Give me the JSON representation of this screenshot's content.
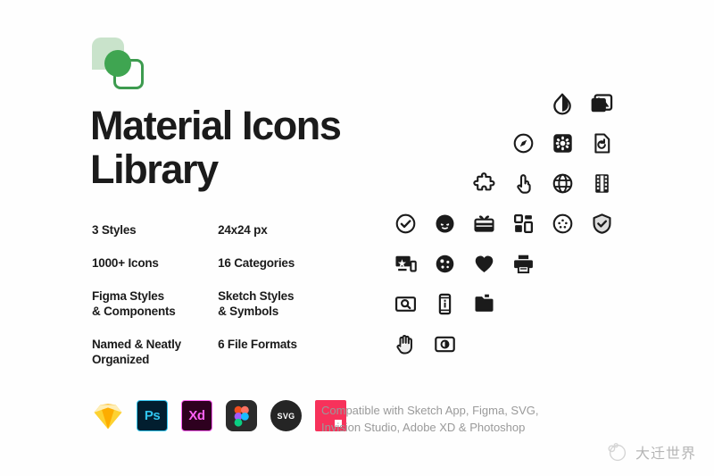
{
  "brand": {
    "logo_name": "material-icons-logo",
    "colors": {
      "leaf": "#c9e3cb",
      "circle": "#3fa551",
      "square_outline": "#3d9b4f",
      "title": "#1b1b1b",
      "muted_text": "#9a9a9a",
      "background": "#fefefe"
    }
  },
  "header": {
    "title_line1": "Material Icons",
    "title_line2": "Library"
  },
  "stats": [
    {
      "left": [
        "3 Styles"
      ],
      "right": [
        "24x24 px"
      ]
    },
    {
      "left": [
        "1000+ Icons"
      ],
      "right": [
        "16 Categories"
      ]
    },
    {
      "left": [
        "Figma Styles",
        "& Components"
      ],
      "right": [
        "Sketch Styles",
        "& Symbols"
      ]
    },
    {
      "left": [
        "Named & Neatly",
        "Organized"
      ],
      "right": [
        "6 File Formats"
      ]
    }
  ],
  "icon_grid": {
    "columns": 6,
    "rows": [
      {
        "offset": 4,
        "icons": [
          "opacity-icon",
          "photo-library-icon"
        ]
      },
      {
        "offset": 3,
        "icons": [
          "explore-icon",
          "settings-applications-icon",
          "restore-page-icon"
        ]
      },
      {
        "offset": 2,
        "icons": [
          "extension-icon",
          "touch-app-icon",
          "language-icon",
          "theaters-icon"
        ]
      },
      {
        "offset": 0,
        "icons": [
          "check-circle-icon",
          "face-icon",
          "card-giftcard-icon",
          "dashboard-icon",
          "sports-baseball-icon",
          "verified-user-icon"
        ]
      },
      {
        "offset": 0,
        "icons": [
          "important-devices-icon",
          "blur-circular-icon",
          "favorite-icon",
          "print-icon"
        ]
      },
      {
        "offset": 0,
        "icons": [
          "screen-search-desktop-icon",
          "perm-device-information-icon",
          "folder-special-icon"
        ]
      },
      {
        "offset": 0,
        "icons": [
          "pan-tool-icon",
          "brightness-medium-icon"
        ]
      }
    ]
  },
  "apps": [
    {
      "name": "sketch-logo",
      "label": ""
    },
    {
      "name": "photoshop-logo",
      "label": "Ps"
    },
    {
      "name": "adobe-xd-logo",
      "label": "Xd"
    },
    {
      "name": "figma-logo",
      "label": ""
    },
    {
      "name": "svg-logo",
      "label": "SVG"
    },
    {
      "name": "invision-logo",
      "label": ""
    }
  ],
  "compatibility": {
    "line1": "Compatible with Sketch App, Figma, SVG,",
    "line2": "Invision Studio, Adobe XD & Photoshop"
  },
  "watermark": {
    "text": "大迁世界"
  }
}
